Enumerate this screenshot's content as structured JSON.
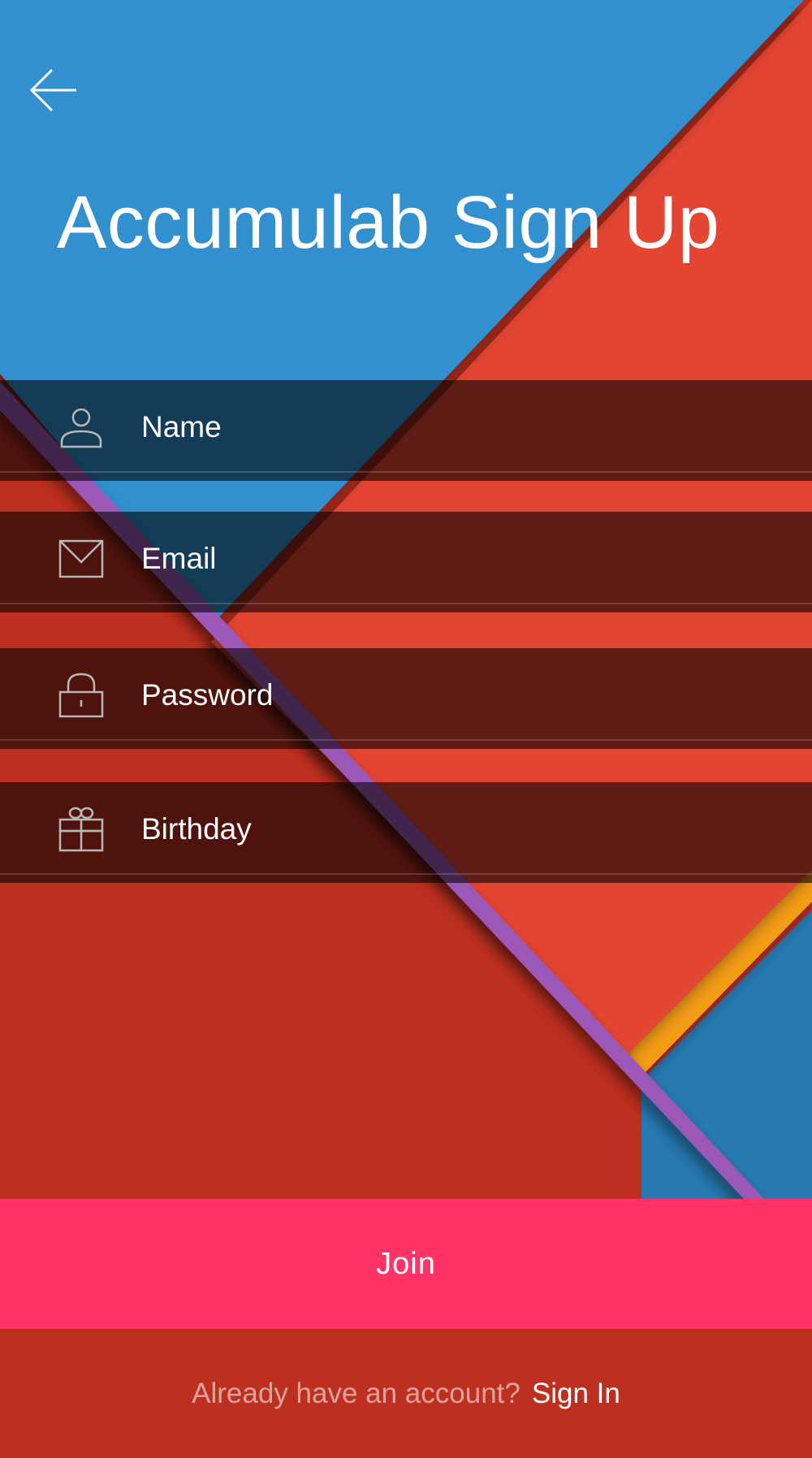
{
  "header": {
    "back_icon": "arrow-left-icon",
    "title": "Accumulab Sign Up"
  },
  "form": {
    "fields": [
      {
        "label": "Name",
        "icon": "user-icon"
      },
      {
        "label": "Email",
        "icon": "mail-icon"
      },
      {
        "label": "Password",
        "icon": "lock-icon"
      },
      {
        "label": "Birthday",
        "icon": "gift-icon"
      }
    ]
  },
  "actions": {
    "join_label": "Join"
  },
  "footer": {
    "prompt": "Already have an account?",
    "signin_label": "Sign In"
  },
  "colors": {
    "blue": "#3390cf",
    "red": "#e34532",
    "dark_red": "#bd2f1f",
    "purple": "#9b59b6",
    "orange": "#f39c12",
    "join_pink": "#ff3366"
  }
}
